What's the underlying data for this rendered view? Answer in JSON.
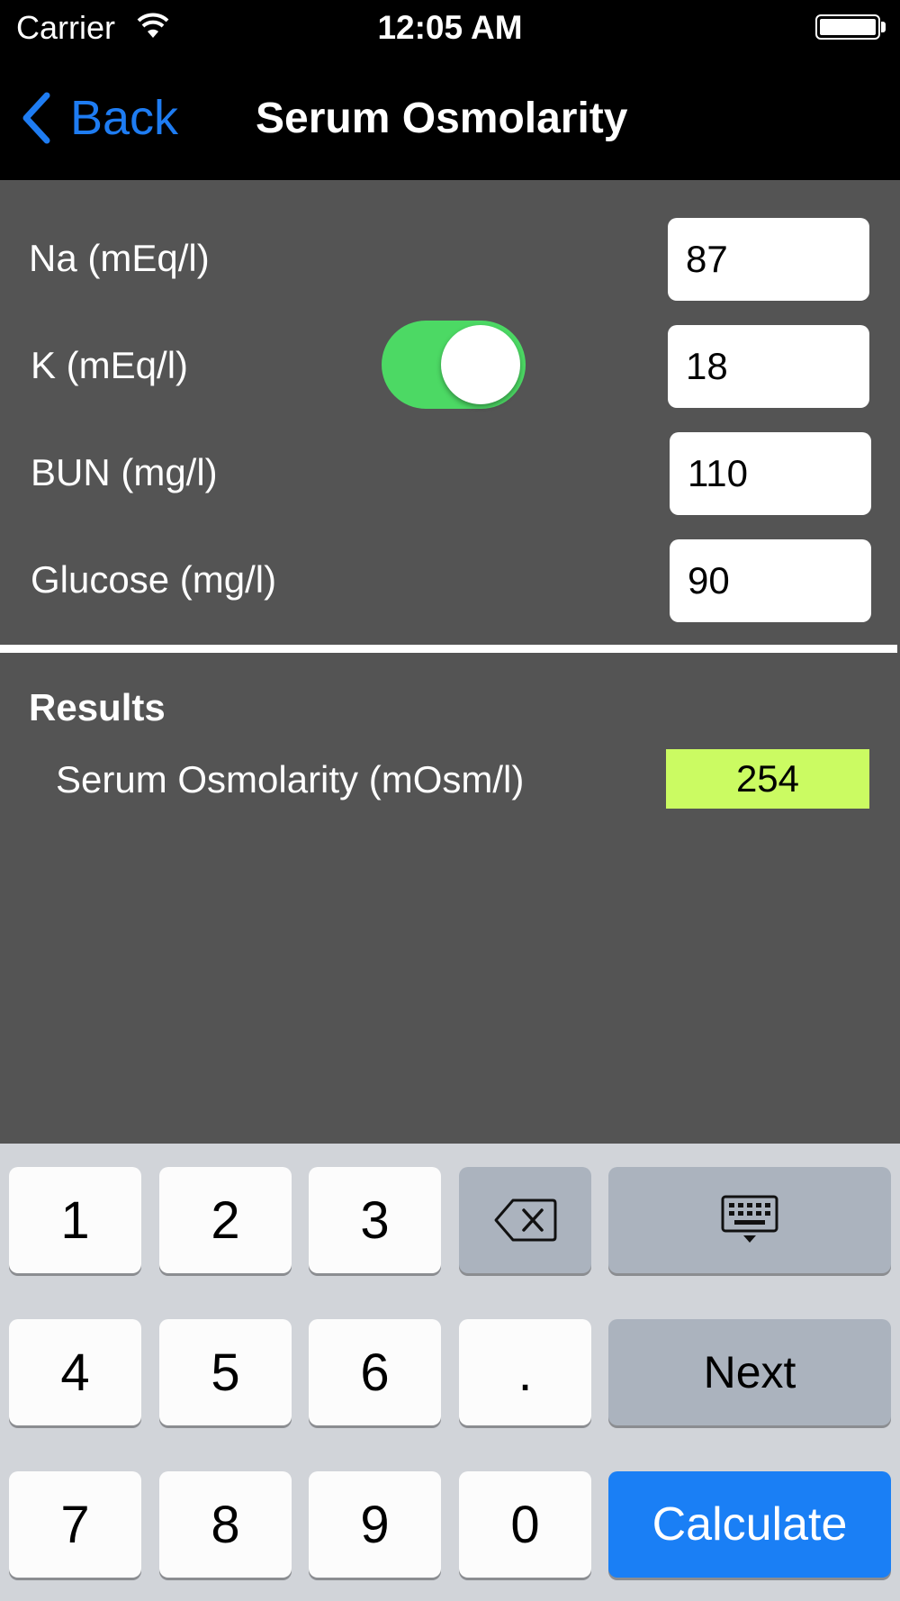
{
  "status_bar": {
    "carrier": "Carrier",
    "time": "12:05 AM",
    "wifi_icon": "wifi-icon",
    "battery_icon": "battery-icon"
  },
  "nav": {
    "back_label": "Back",
    "title": "Serum Osmolarity",
    "back_icon": "chevron-left-icon"
  },
  "form": {
    "na_label": "Na (mEq/l)",
    "na_value": "87",
    "k_label": "K (mEq/l)",
    "k_value": "18",
    "k_toggle_on": true,
    "bun_label": "BUN (mg/l)",
    "bun_value": "110",
    "glucose_label": "Glucose (mg/l)",
    "glucose_value": "90"
  },
  "results": {
    "heading": "Results",
    "label": "Serum Osmolarity (mOsm/l)",
    "value": "254"
  },
  "keyboard": {
    "keys": [
      "1",
      "2",
      "3",
      "4",
      "5",
      "6",
      ".",
      "7",
      "8",
      "9",
      "0"
    ],
    "next_label": "Next",
    "calculate_label": "Calculate",
    "delete_icon": "backspace-icon",
    "dismiss_icon": "keyboard-dismiss-icon"
  },
  "colors": {
    "accent": "#1e7cf2",
    "toggle_on": "#4cd964",
    "result_highlight": "#cbfb62",
    "background": "#545454",
    "calculate_key": "#1a7ff5"
  }
}
